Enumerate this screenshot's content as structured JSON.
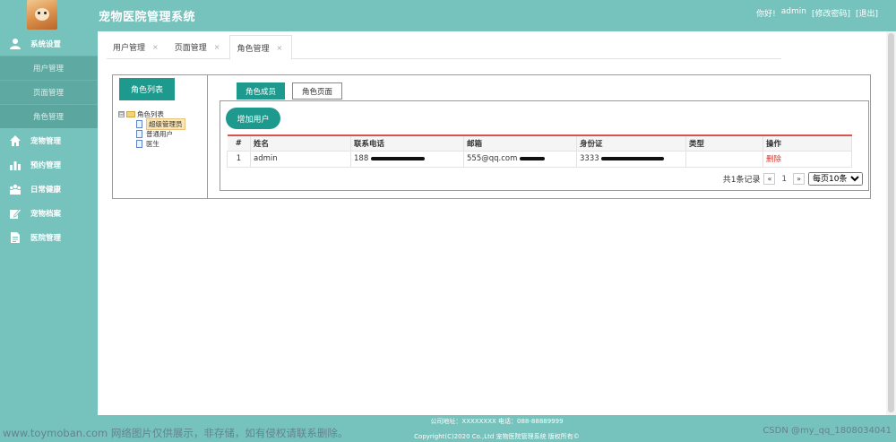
{
  "header": {
    "title": "宠物医院管理系统",
    "greeting": "你好!",
    "username": "admin",
    "change_password": "[修改密码]",
    "logout": "[退出]"
  },
  "sidebar": {
    "items": [
      {
        "label": "系统设置",
        "icon": "user-settings-icon"
      },
      {
        "label": "宠物管理",
        "icon": "home-icon"
      },
      {
        "label": "预约管理",
        "icon": "bar-chart-icon"
      },
      {
        "label": "日常健康",
        "icon": "group-icon"
      },
      {
        "label": "宠物档案",
        "icon": "edit-icon"
      },
      {
        "label": "医院管理",
        "icon": "document-icon"
      }
    ],
    "sub_items": [
      "用户管理",
      "页面管理",
      "角色管理"
    ]
  },
  "tabs": [
    {
      "label": "用户管理",
      "close": "×"
    },
    {
      "label": "页面管理",
      "close": "×"
    },
    {
      "label": "角色管理",
      "close": "×"
    }
  ],
  "role_panel": {
    "list_button": "角色列表",
    "tree_root": "角色列表",
    "tree_expander": "⊟",
    "tree_children": [
      "超级管理员",
      "普通用户",
      "医生"
    ]
  },
  "inner_tabs": [
    "角色成员",
    "角色页面"
  ],
  "add_button": "增加用户",
  "table": {
    "headers": [
      "#",
      "姓名",
      "联系电话",
      "邮箱",
      "身份证",
      "类型",
      "操作"
    ],
    "rows": [
      {
        "index": "1",
        "name": "admin",
        "phone": "188",
        "email": "555@qq.com",
        "id_card": "3333",
        "type": "",
        "action": "删除"
      }
    ]
  },
  "pager": {
    "total": "共1条记录",
    "prev": "«",
    "current": "1",
    "next": "»",
    "page_size": "每页10条"
  },
  "footer": {
    "line1": "公司地址：XXXXXXXX 电话：088-88889999",
    "line2": "Copyright(C)2020 Co.,Ltd 宠物医院管理系统 版权所有©"
  },
  "watermark": {
    "left": "www.toymoban.com 网络图片仅供展示，非存储，如有侵权请联系删除。",
    "right": "CSDN @my_qq_1808034041"
  },
  "colors": {
    "theme": "#76c2bc",
    "accent": "#1e998d",
    "danger": "#e0322b"
  }
}
